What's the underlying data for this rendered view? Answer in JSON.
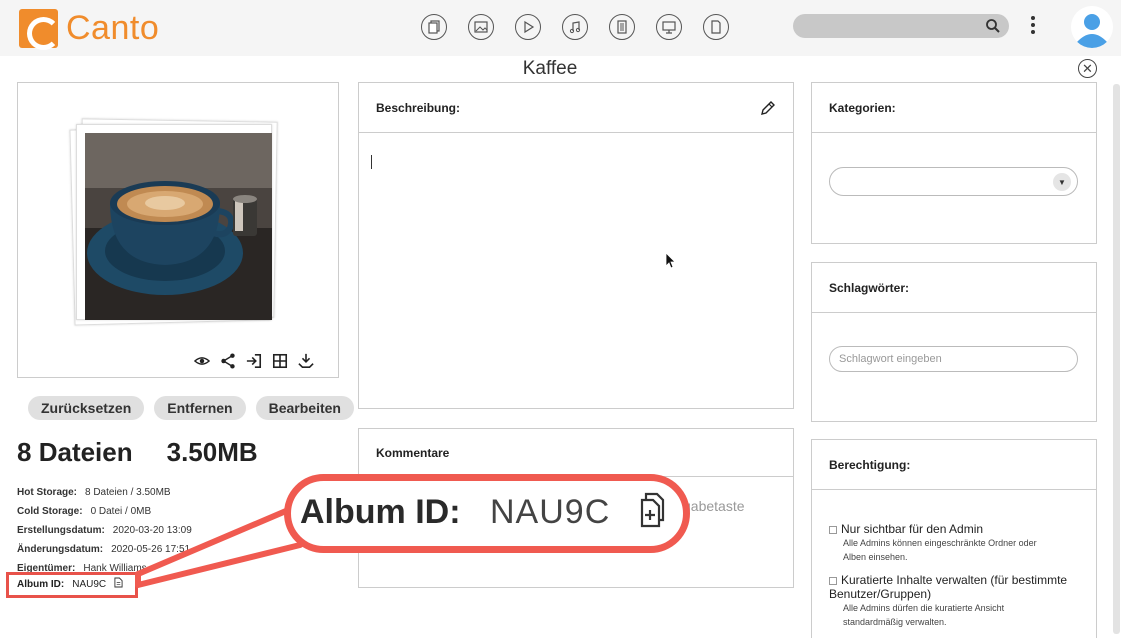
{
  "app": {
    "brand": "Canto",
    "brand_color": "#f08c2c"
  },
  "header": {
    "type_icons": [
      "all-files-icon",
      "image-icon",
      "video-icon",
      "audio-icon",
      "document-icon",
      "presentation-icon",
      "other-file-icon"
    ],
    "search": {
      "placeholder": ""
    }
  },
  "page": {
    "title": "Kaffee"
  },
  "preview": {
    "actions": [
      "eye-icon",
      "share-icon",
      "move-icon",
      "grid-icon",
      "download-icon"
    ]
  },
  "buttons": {
    "reset": "Zurücksetzen",
    "remove": "Entfernen",
    "edit": "Bearbeiten"
  },
  "stats": {
    "count": "8",
    "count_unit": "Dateien",
    "size": "3.50MB"
  },
  "info": [
    {
      "key": "Hot Storage:",
      "value": "8 Dateien / 3.50MB"
    },
    {
      "key": "Cold Storage:",
      "value": "0 Datei / 0MB"
    },
    {
      "key": "Erstellungsdatum:",
      "value": "2020-03-20 13:09"
    },
    {
      "key": "Änderungsdatum:",
      "value": "2020-05-26 17:51"
    },
    {
      "key": "Eigentümer:",
      "value": "Hank Williams"
    }
  ],
  "album": {
    "key": "Album ID:",
    "value": "NAU9C"
  },
  "description": {
    "title": "Beschreibung:",
    "value": ""
  },
  "comments": {
    "title": "Kommentare",
    "hint_visible": "gabetaste"
  },
  "categories": {
    "title": "Kategorien:",
    "selected": ""
  },
  "keywords": {
    "title": "Schlagwörter:",
    "placeholder": "Schlagwort eingeben"
  },
  "permissions": {
    "title": "Berechtigung:",
    "items": [
      {
        "label": "Nur sichtbar für den Admin",
        "desc_line1": "Alle Admins können eingeschränkte Ordner oder",
        "desc_line2": "Alben einsehen."
      },
      {
        "label": "Kuratierte Inhalte verwalten (für bestimmte",
        "label2": "Benutzer/Gruppen)",
        "desc_line1": "Alle Admins dürfen die kuratierte Ansicht",
        "desc_line2": "standardmäßig verwalten."
      }
    ]
  },
  "callout": {
    "label": "Album ID:",
    "value": "NAU9C",
    "color": "#f05a50"
  }
}
